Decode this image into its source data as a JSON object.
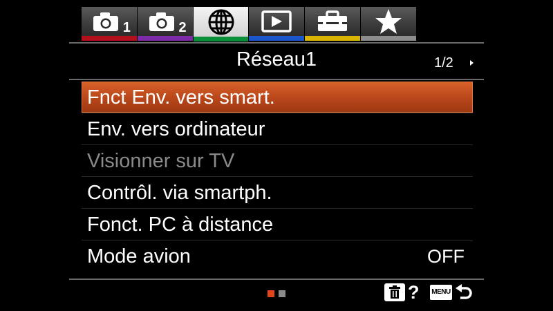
{
  "tabs": [
    {
      "icon": "camera-icon",
      "number": "1",
      "stripe": "#b3101c",
      "active": false
    },
    {
      "icon": "camera-icon",
      "number": "2",
      "stripe": "#7c2aa8",
      "active": false
    },
    {
      "icon": "globe-icon",
      "number": "",
      "stripe": "#0a8f3a",
      "active": true
    },
    {
      "icon": "playback-icon",
      "number": "",
      "stripe": "#1b55c9",
      "active": false
    },
    {
      "icon": "toolbox-icon",
      "number": "",
      "stripe": "#d9b400",
      "active": false
    },
    {
      "icon": "star-icon",
      "number": "",
      "stripe": "#8c8c8c",
      "active": false
    }
  ],
  "header": {
    "title": "Réseau1",
    "page": "1/2"
  },
  "menu": {
    "items": [
      {
        "label": "Fnct Env. vers smart.",
        "value": ""
      },
      {
        "label": "Env. vers ordinateur",
        "value": ""
      },
      {
        "label": "Visionner sur TV",
        "value": ""
      },
      {
        "label": "Contrôl. via smartph.",
        "value": ""
      },
      {
        "label": "Fonct. PC à distance",
        "value": ""
      },
      {
        "label": "Mode avion",
        "value": "OFF"
      }
    ]
  },
  "footer": {
    "page_dots": [
      {
        "color": "#e0451c"
      },
      {
        "color": "#8a8a8a"
      }
    ],
    "help": "?",
    "menu_key": "MENU"
  },
  "colors": {
    "selected": "#c24f1e",
    "disabled_text": "#8a8a8a"
  }
}
